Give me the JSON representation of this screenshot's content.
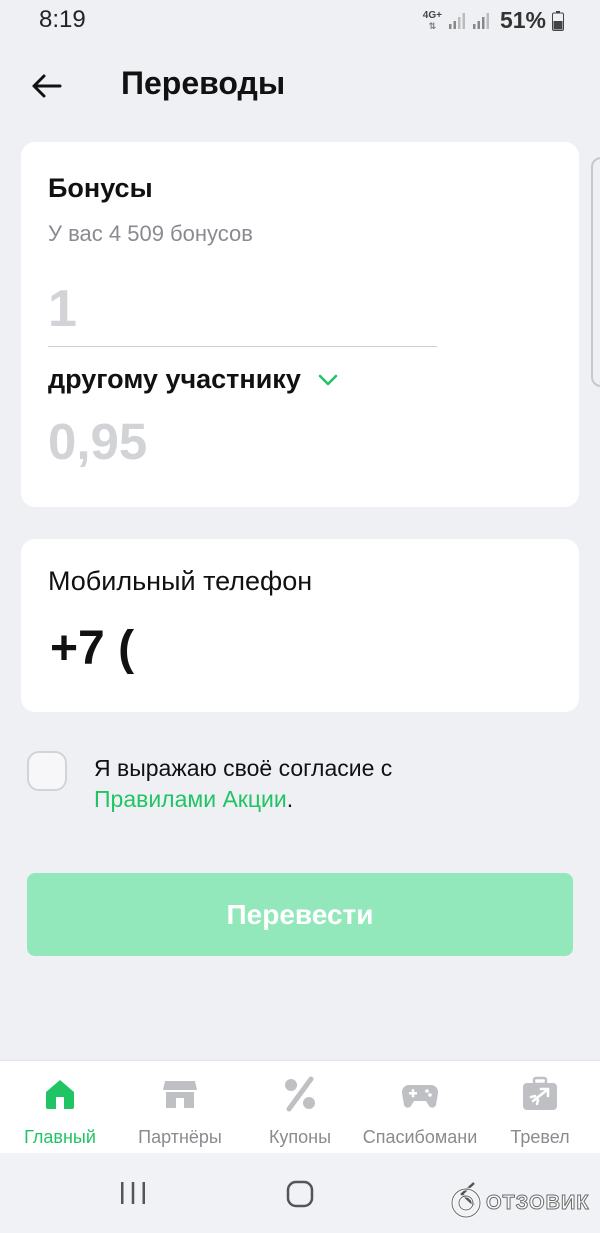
{
  "status_bar": {
    "time": "8:19",
    "network": "4G+",
    "battery_percent": "51%"
  },
  "header": {
    "title": "Переводы"
  },
  "bonus_card": {
    "title": "Бонусы",
    "subtitle": "У вас 4 509 бонусов",
    "amount_value": "1",
    "recipient_label": "другому участнику",
    "rate_value": "0,95"
  },
  "phone_card": {
    "title": "Мобильный телефон",
    "value": "+7 ("
  },
  "consent": {
    "text": "Я выражаю своё согласие с ",
    "link": "Правилами Акции",
    "suffix": "."
  },
  "submit": {
    "label": "Перевести"
  },
  "bottom_nav": {
    "items": [
      {
        "label": "Главный",
        "icon": "home-icon",
        "active": true
      },
      {
        "label": "Партнёры",
        "icon": "store-icon",
        "active": false
      },
      {
        "label": "Купоны",
        "icon": "percent-icon",
        "active": false
      },
      {
        "label": "Спасибомани",
        "icon": "gamepad-icon",
        "active": false
      },
      {
        "label": "Тревел",
        "icon": "suitcase-plane-icon",
        "active": false
      }
    ]
  },
  "watermark": {
    "text": "ОТЗОВИК"
  },
  "colors": {
    "accent": "#21c464",
    "button_disabled": "#93e8bb",
    "background": "#eff0f4",
    "muted_text": "#8a8b90",
    "placeholder": "#d2d3d7"
  }
}
